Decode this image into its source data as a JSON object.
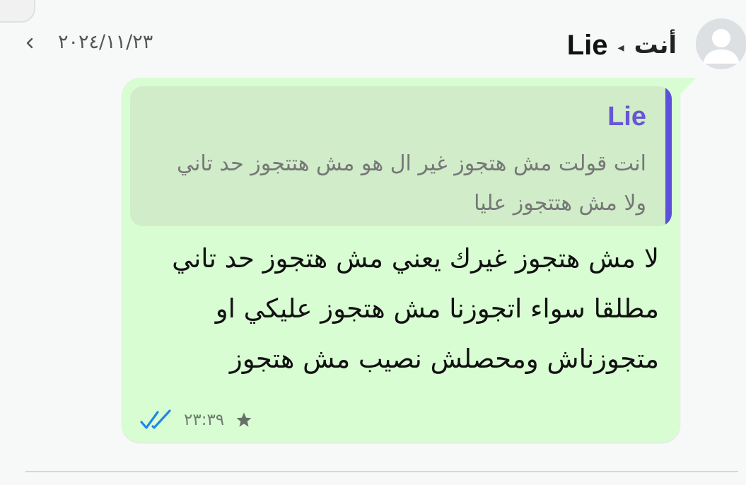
{
  "header": {
    "you_label": "أنت",
    "recipient_name": "Lie",
    "date": "٢٠٢٤/١١/٢٣"
  },
  "quote": {
    "author": "Lie",
    "text": "انت قولت مش هتجوز غير ال هو مش هتتجوز حد تاني ولا مش هتتجوز عليا"
  },
  "message": {
    "text": "لا مش هتجوز غيرك يعني مش هتجوز حد تاني مطلقا سواء اتجوزنا مش هتجوز عليكي او متجوزناش ومحصلش نصيب مش هتجوز",
    "time": "٢٣:٣٩",
    "starred": true,
    "status": "read"
  },
  "icons": {
    "avatar": "default-avatar-icon",
    "arrow": "arrow-left-icon",
    "chevron": "chevron-left-icon",
    "star": "star-icon",
    "ticks": "double-check-icon"
  },
  "colors": {
    "bubble": "#d9fdd3",
    "quote_bg": "#d0ecc9",
    "quote_bar": "#5b50dc",
    "quote_author": "#6756d6",
    "read_ticks": "#1e88e5"
  }
}
